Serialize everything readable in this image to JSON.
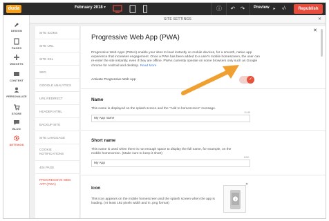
{
  "topbar": {
    "logo": "duda",
    "date": "February 2018",
    "preview_label": "Preview",
    "republish_label": "Republish"
  },
  "leftnav": {
    "items": [
      {
        "label": "DESIGN"
      },
      {
        "label": "PAGES"
      },
      {
        "label": "WIDGETS"
      },
      {
        "label": "CONTENT"
      },
      {
        "label": "PERSONALIZE"
      },
      {
        "label": "STORE"
      },
      {
        "label": "BLOG"
      },
      {
        "label": "SETTINGS"
      }
    ]
  },
  "settings_header": {
    "title": "SITE SETTINGS"
  },
  "menu": {
    "items": [
      {
        "label": "SITE ICONS"
      },
      {
        "label": "SITE URL"
      },
      {
        "label": "SITE SSL"
      },
      {
        "label": "SEO"
      },
      {
        "label": "GOOGLE ANALYTICS"
      },
      {
        "label": "URL REDIRECT"
      },
      {
        "label": "HEADER HTML"
      },
      {
        "label": "BACKUP SITE"
      },
      {
        "label": "SITE LANGUAGE"
      },
      {
        "label": "COOKIE NOTIFICATIONS"
      },
      {
        "label": "404 PAGE"
      },
      {
        "label": "PROGRESSIVE WEB APP (PWA)"
      }
    ]
  },
  "pwa": {
    "title": "Progressive Web App (PWA)",
    "intro": "Progressive Web Apps (PWAs) enable your sites to load instantly on mobile devices, for a smooth, native app experience that increases engagement. Once a PWA has been added to a user's mobile homescreen, the user can re-enter the site instantly, even if they are offline.",
    "intro_note": "PWAs currently operate on some browsers only such as Google chrome for Android and desktop.",
    "read_more": "Read More",
    "activate_label": "Activate Progressive Web App",
    "activate_on": true,
    "name": {
      "title": "Name",
      "desc": "This name is displayed on the splash screen and the \"Add to homescreen\" message.",
      "counter": "11/45",
      "value": "My App name"
    },
    "short_name": {
      "title": "Short name",
      "desc": "This name is used when there is not enough space to display the full name, for example, on the mobile homescreen. (Make sure to keep it short)",
      "counter": "6/50",
      "value": "My App"
    },
    "icon": {
      "title": "Icon",
      "desc": "This icon appears on the mobile homescreen and the splash screen when the app is loading. (At least 192 pixels width and in .png format)"
    }
  },
  "colors": {
    "accent": "#e74c3c",
    "topbar": "#2b2b2b",
    "arrow": "#f0a030",
    "link": "#3b7ddd"
  }
}
